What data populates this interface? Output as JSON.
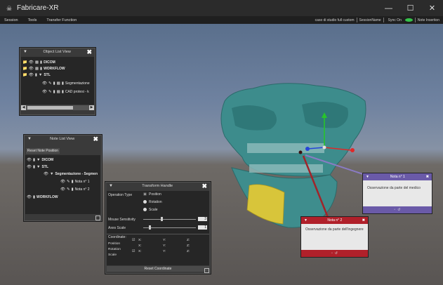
{
  "window": {
    "title": "Fabricare-XR",
    "app_icon": "skull-icon",
    "minimize": "—",
    "maximize": "☐",
    "close": "✕"
  },
  "menu": {
    "items": [
      "Session",
      "Tools",
      "Transfer Function"
    ],
    "case_name": "caso di studio full custom",
    "session_name": "SessionName",
    "sync_label": "Sync On",
    "note_insertion": "Note Insertion"
  },
  "object_list": {
    "title": "Object List View",
    "rows": [
      {
        "label": "DICOM",
        "bold": true
      },
      {
        "label": "WORKFLOW",
        "bold": true
      },
      {
        "label": "STL",
        "bold": true
      },
      {
        "label": "Segmentazione",
        "bold": false
      },
      {
        "label": "CAD protesi - k",
        "bold": false
      }
    ]
  },
  "note_list": {
    "title": "Note List View",
    "reset_button": "Reset Note Position",
    "rows": [
      {
        "label": "DICOM",
        "bold": true
      },
      {
        "label": "STL",
        "bold": true
      },
      {
        "label": "Segmentazione - Segmen",
        "bold": true
      },
      {
        "label": "Nota n° 1",
        "bold": false
      },
      {
        "label": "Nota n° 2",
        "bold": false
      },
      {
        "label": "WORKFLOW",
        "bold": true
      }
    ]
  },
  "transform": {
    "title": "Transform Handle",
    "operation_type_label": "Operation Type",
    "operations": [
      "Position",
      "Rotation",
      "Scale"
    ],
    "selected_operation": 0,
    "mouse_sensitivity_label": "Mouse Sensitivity",
    "mouse_sensitivity_value": "3",
    "axes_scale_label": "Axes Scale",
    "axes_scale_value": "1",
    "coordinate_label": "Coordinate:",
    "rows": [
      "Position",
      "Rotation",
      "Scale"
    ],
    "axis_labels": [
      "X:",
      "Y:",
      "Z:"
    ],
    "reset_button": "Reset Coordinate"
  },
  "note1": {
    "title": "Nota n° 1",
    "text": "Osservazione da parte del medico",
    "color": "#6a5aa8"
  },
  "note2": {
    "title": "Nota n° 2",
    "text": "Osservazione da parte dell'ingegnere",
    "color": "#b0202a"
  }
}
